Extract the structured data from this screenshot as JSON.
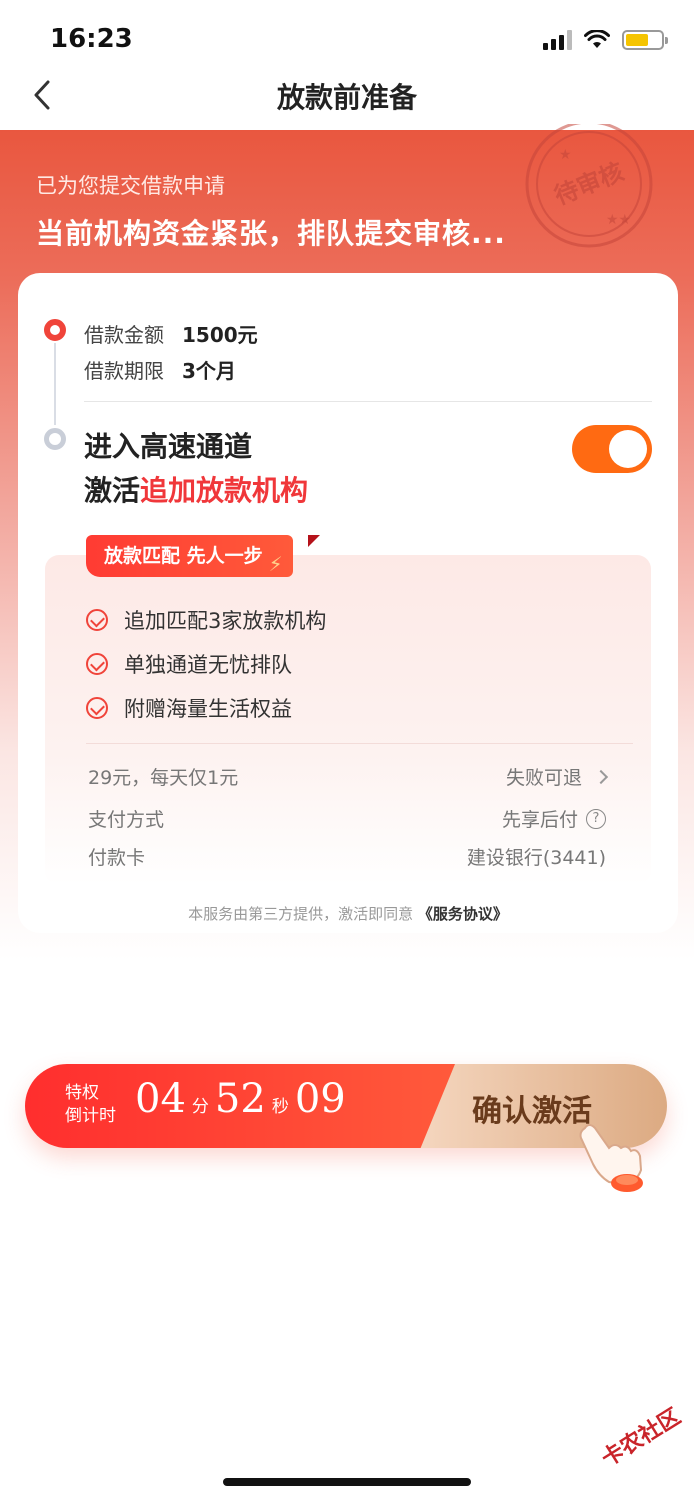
{
  "status_bar": {
    "time": "16:23"
  },
  "nav": {
    "title": "放款前准备"
  },
  "hero": {
    "subtitle": "已为您提交借款申请",
    "title": "当前机构资金紧张，排队提交审核...",
    "stamp_text": "待审核"
  },
  "loan": {
    "amount_label": "借款金额",
    "amount_value": "1500元",
    "term_label": "借款期限",
    "term_value": "3个月"
  },
  "channel": {
    "title_line1": "进入高速通道",
    "title_line2_prefix": "激活",
    "title_line2_highlight": "追加放款机构",
    "toggle_on": true
  },
  "benefits": {
    "tag": "放款匹配 先人一步",
    "items": [
      "追加匹配3家放款机构",
      "单独通道无忧排队",
      "附赠海量生活权益"
    ]
  },
  "payment": {
    "price_text": "29元，每天仅1元",
    "refund_text": "失败可退",
    "method_label": "支付方式",
    "method_value": "先享后付",
    "card_label": "付款卡",
    "card_value": "建设银行(3441)"
  },
  "agreement": {
    "prefix": "本服务由第三方提供，激活即同意",
    "link": "《服务协议》"
  },
  "cta": {
    "label_line1": "特权",
    "label_line2": "倒计时",
    "minutes": "04",
    "minutes_unit": "分",
    "seconds": "52",
    "seconds_unit": "秒",
    "centis": "09",
    "button": "确认激活"
  },
  "watermark": "卡农社区"
}
